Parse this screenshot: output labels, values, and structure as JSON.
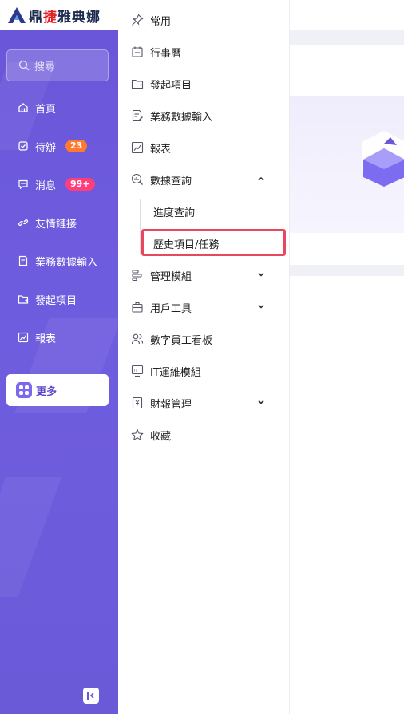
{
  "logo": {
    "text_part1": "鼎",
    "text_red": "捷",
    "text_part2": "雅典娜"
  },
  "sidebar": {
    "search_placeholder": "搜尋",
    "items": [
      {
        "label": "首頁",
        "icon": "home-icon"
      },
      {
        "label": "待辦",
        "icon": "todo-icon",
        "badge": "23"
      },
      {
        "label": "消息",
        "icon": "message-icon",
        "badge": "99+"
      },
      {
        "label": "友情鏈接",
        "icon": "link-icon"
      },
      {
        "label": "業務數據輸入",
        "icon": "form-icon"
      },
      {
        "label": "發起項目",
        "icon": "folder-icon"
      },
      {
        "label": "報表",
        "icon": "chart-icon"
      }
    ],
    "more_label": "更多"
  },
  "submenu": {
    "items": [
      {
        "label": "常用"
      },
      {
        "label": "行事曆"
      },
      {
        "label": "發起項目"
      },
      {
        "label": "業務數據輸入"
      },
      {
        "label": "報表"
      },
      {
        "label": "數據查詢"
      },
      {
        "label": "管理模組"
      },
      {
        "label": "用戶工具"
      },
      {
        "label": "數字員工看板"
      },
      {
        "label": "IT運維模組"
      },
      {
        "label": "財報管理"
      },
      {
        "label": "收藏"
      }
    ],
    "query_children": [
      {
        "label": "進度查詢"
      },
      {
        "label": "歷史項目/任務"
      }
    ]
  },
  "colors": {
    "sidebar": "#6a56d9",
    "highlight": "#e8475d",
    "badge_orange": "#ff7a2f",
    "badge_pink": "#ff3d7a"
  }
}
